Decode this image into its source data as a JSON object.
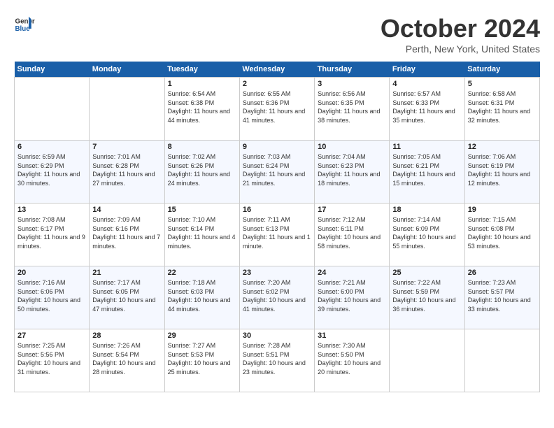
{
  "header": {
    "logo_line1": "General",
    "logo_line2": "Blue",
    "month": "October 2024",
    "location": "Perth, New York, United States"
  },
  "days_of_week": [
    "Sunday",
    "Monday",
    "Tuesday",
    "Wednesday",
    "Thursday",
    "Friday",
    "Saturday"
  ],
  "weeks": [
    [
      {
        "day": "",
        "sunrise": "",
        "sunset": "",
        "daylight": ""
      },
      {
        "day": "",
        "sunrise": "",
        "sunset": "",
        "daylight": ""
      },
      {
        "day": "1",
        "sunrise": "Sunrise: 6:54 AM",
        "sunset": "Sunset: 6:38 PM",
        "daylight": "Daylight: 11 hours and 44 minutes."
      },
      {
        "day": "2",
        "sunrise": "Sunrise: 6:55 AM",
        "sunset": "Sunset: 6:36 PM",
        "daylight": "Daylight: 11 hours and 41 minutes."
      },
      {
        "day": "3",
        "sunrise": "Sunrise: 6:56 AM",
        "sunset": "Sunset: 6:35 PM",
        "daylight": "Daylight: 11 hours and 38 minutes."
      },
      {
        "day": "4",
        "sunrise": "Sunrise: 6:57 AM",
        "sunset": "Sunset: 6:33 PM",
        "daylight": "Daylight: 11 hours and 35 minutes."
      },
      {
        "day": "5",
        "sunrise": "Sunrise: 6:58 AM",
        "sunset": "Sunset: 6:31 PM",
        "daylight": "Daylight: 11 hours and 32 minutes."
      }
    ],
    [
      {
        "day": "6",
        "sunrise": "Sunrise: 6:59 AM",
        "sunset": "Sunset: 6:29 PM",
        "daylight": "Daylight: 11 hours and 30 minutes."
      },
      {
        "day": "7",
        "sunrise": "Sunrise: 7:01 AM",
        "sunset": "Sunset: 6:28 PM",
        "daylight": "Daylight: 11 hours and 27 minutes."
      },
      {
        "day": "8",
        "sunrise": "Sunrise: 7:02 AM",
        "sunset": "Sunset: 6:26 PM",
        "daylight": "Daylight: 11 hours and 24 minutes."
      },
      {
        "day": "9",
        "sunrise": "Sunrise: 7:03 AM",
        "sunset": "Sunset: 6:24 PM",
        "daylight": "Daylight: 11 hours and 21 minutes."
      },
      {
        "day": "10",
        "sunrise": "Sunrise: 7:04 AM",
        "sunset": "Sunset: 6:23 PM",
        "daylight": "Daylight: 11 hours and 18 minutes."
      },
      {
        "day": "11",
        "sunrise": "Sunrise: 7:05 AM",
        "sunset": "Sunset: 6:21 PM",
        "daylight": "Daylight: 11 hours and 15 minutes."
      },
      {
        "day": "12",
        "sunrise": "Sunrise: 7:06 AM",
        "sunset": "Sunset: 6:19 PM",
        "daylight": "Daylight: 11 hours and 12 minutes."
      }
    ],
    [
      {
        "day": "13",
        "sunrise": "Sunrise: 7:08 AM",
        "sunset": "Sunset: 6:17 PM",
        "daylight": "Daylight: 11 hours and 9 minutes."
      },
      {
        "day": "14",
        "sunrise": "Sunrise: 7:09 AM",
        "sunset": "Sunset: 6:16 PM",
        "daylight": "Daylight: 11 hours and 7 minutes."
      },
      {
        "day": "15",
        "sunrise": "Sunrise: 7:10 AM",
        "sunset": "Sunset: 6:14 PM",
        "daylight": "Daylight: 11 hours and 4 minutes."
      },
      {
        "day": "16",
        "sunrise": "Sunrise: 7:11 AM",
        "sunset": "Sunset: 6:13 PM",
        "daylight": "Daylight: 11 hours and 1 minute."
      },
      {
        "day": "17",
        "sunrise": "Sunrise: 7:12 AM",
        "sunset": "Sunset: 6:11 PM",
        "daylight": "Daylight: 10 hours and 58 minutes."
      },
      {
        "day": "18",
        "sunrise": "Sunrise: 7:14 AM",
        "sunset": "Sunset: 6:09 PM",
        "daylight": "Daylight: 10 hours and 55 minutes."
      },
      {
        "day": "19",
        "sunrise": "Sunrise: 7:15 AM",
        "sunset": "Sunset: 6:08 PM",
        "daylight": "Daylight: 10 hours and 53 minutes."
      }
    ],
    [
      {
        "day": "20",
        "sunrise": "Sunrise: 7:16 AM",
        "sunset": "Sunset: 6:06 PM",
        "daylight": "Daylight: 10 hours and 50 minutes."
      },
      {
        "day": "21",
        "sunrise": "Sunrise: 7:17 AM",
        "sunset": "Sunset: 6:05 PM",
        "daylight": "Daylight: 10 hours and 47 minutes."
      },
      {
        "day": "22",
        "sunrise": "Sunrise: 7:18 AM",
        "sunset": "Sunset: 6:03 PM",
        "daylight": "Daylight: 10 hours and 44 minutes."
      },
      {
        "day": "23",
        "sunrise": "Sunrise: 7:20 AM",
        "sunset": "Sunset: 6:02 PM",
        "daylight": "Daylight: 10 hours and 41 minutes."
      },
      {
        "day": "24",
        "sunrise": "Sunrise: 7:21 AM",
        "sunset": "Sunset: 6:00 PM",
        "daylight": "Daylight: 10 hours and 39 minutes."
      },
      {
        "day": "25",
        "sunrise": "Sunrise: 7:22 AM",
        "sunset": "Sunset: 5:59 PM",
        "daylight": "Daylight: 10 hours and 36 minutes."
      },
      {
        "day": "26",
        "sunrise": "Sunrise: 7:23 AM",
        "sunset": "Sunset: 5:57 PM",
        "daylight": "Daylight: 10 hours and 33 minutes."
      }
    ],
    [
      {
        "day": "27",
        "sunrise": "Sunrise: 7:25 AM",
        "sunset": "Sunset: 5:56 PM",
        "daylight": "Daylight: 10 hours and 31 minutes."
      },
      {
        "day": "28",
        "sunrise": "Sunrise: 7:26 AM",
        "sunset": "Sunset: 5:54 PM",
        "daylight": "Daylight: 10 hours and 28 minutes."
      },
      {
        "day": "29",
        "sunrise": "Sunrise: 7:27 AM",
        "sunset": "Sunset: 5:53 PM",
        "daylight": "Daylight: 10 hours and 25 minutes."
      },
      {
        "day": "30",
        "sunrise": "Sunrise: 7:28 AM",
        "sunset": "Sunset: 5:51 PM",
        "daylight": "Daylight: 10 hours and 23 minutes."
      },
      {
        "day": "31",
        "sunrise": "Sunrise: 7:30 AM",
        "sunset": "Sunset: 5:50 PM",
        "daylight": "Daylight: 10 hours and 20 minutes."
      },
      {
        "day": "",
        "sunrise": "",
        "sunset": "",
        "daylight": ""
      },
      {
        "day": "",
        "sunrise": "",
        "sunset": "",
        "daylight": ""
      }
    ]
  ]
}
